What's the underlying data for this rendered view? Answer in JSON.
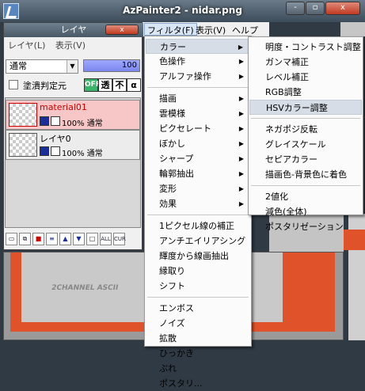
{
  "window": {
    "title": "AzPainter2 - nidar.png",
    "min_glyph": "-",
    "max_glyph": "▫",
    "close_glyph": "x"
  },
  "menubar": {
    "filter": "フィルタ(F)",
    "view": "表示(V)",
    "help": "ヘルプ(H)"
  },
  "layer_panel": {
    "title": "レイヤ",
    "close_glyph": "x",
    "menu": [
      "レイヤ(L)",
      "表示(V)"
    ],
    "blend_mode": "通常",
    "opacity": 100,
    "opacity_label": "100",
    "check_label": "塗潰判定元",
    "toggles": {
      "off": "OFF",
      "trans": "透",
      "not": "不",
      "alpha": "α"
    },
    "layers": [
      {
        "name": "material01",
        "mode": "100% 通常",
        "selected": true
      },
      {
        "name": "レイヤ0",
        "mode": "100% 通常",
        "selected": false
      }
    ],
    "toolbar": [
      "new-layer",
      "copy-layer",
      "delete-layer",
      "merge-layer",
      "move-up",
      "move-down",
      "clear",
      "ALL",
      "CUR"
    ],
    "toolbar_all": "ALL",
    "toolbar_cur": "CUR"
  },
  "canvas": {
    "text": "2CHANNEL ASCII"
  },
  "filter_menu": {
    "items": [
      {
        "label": "カラー",
        "sub": true,
        "highlight": true
      },
      {
        "label": "色操作",
        "sub": true
      },
      {
        "label": "アルファ操作",
        "sub": true
      },
      {
        "sep": true
      },
      {
        "label": "描画",
        "sub": true
      },
      {
        "label": "雲模様",
        "sub": true
      },
      {
        "label": "ピクセレート",
        "sub": true
      },
      {
        "label": "ぼかし",
        "sub": true
      },
      {
        "label": "シャープ",
        "sub": true
      },
      {
        "label": "輪郭抽出",
        "sub": true
      },
      {
        "label": "変形",
        "sub": true
      },
      {
        "label": "効果",
        "sub": true
      },
      {
        "sep": true
      },
      {
        "label": "1ピクセル線の補正"
      },
      {
        "label": "アンチエイリアシング"
      },
      {
        "label": "輝度から線画抽出"
      },
      {
        "label": "縁取り"
      },
      {
        "label": "シフト"
      },
      {
        "sep": true
      },
      {
        "label": "エンボス"
      },
      {
        "label": "ノイズ"
      },
      {
        "label": "拡散"
      },
      {
        "label": "ひっかき"
      },
      {
        "label": "ぶれ"
      },
      {
        "label": "ポスタリ..."
      }
    ],
    "arrow_glyph": "▶"
  },
  "color_submenu": {
    "items": [
      {
        "label": "明度・コントラスト調整"
      },
      {
        "label": "ガンマ補正"
      },
      {
        "label": "レベル補正"
      },
      {
        "label": "RGB調整"
      },
      {
        "label": "HSVカラー調整",
        "highlight": true
      },
      {
        "sep": true
      },
      {
        "label": "ネガポジ反転"
      },
      {
        "label": "グレイスケール"
      },
      {
        "label": "セピアカラー"
      },
      {
        "label": "描画色-背景色に着色"
      },
      {
        "sep": true
      },
      {
        "label": "2値化"
      },
      {
        "label": "減色(全体)"
      },
      {
        "label": "ポスタリゼーション"
      }
    ]
  }
}
